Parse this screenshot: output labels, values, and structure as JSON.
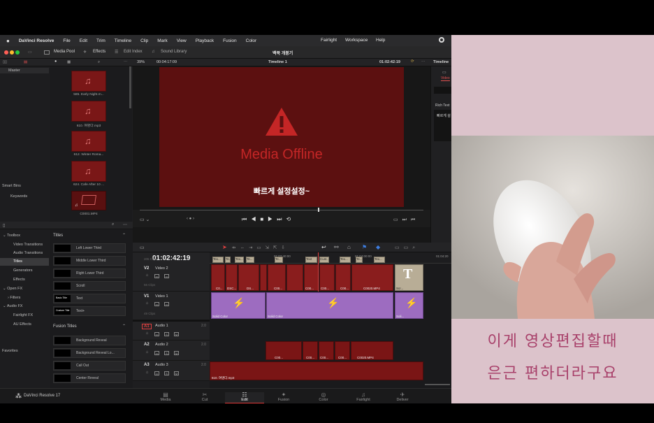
{
  "menubar": {
    "apple": "",
    "app": "DaVinci Resolve",
    "items": [
      "File",
      "Edit",
      "Trim",
      "Timeline",
      "Clip",
      "Mark",
      "View",
      "Playback",
      "Fusion",
      "Color"
    ],
    "right_items": [
      "Fairlight",
      "Workspace",
      "Help"
    ]
  },
  "toolbar": {
    "media_pool": "Media Pool",
    "effects": "Effects",
    "edit_index": "Edit Index",
    "sound_library": "Sound Library",
    "project_title": "백북 개봉기"
  },
  "viewer_bar": {
    "zoom": "39%",
    "timecode_left": "00:04:17:09",
    "timeline_name": "Timeline 1",
    "timecode_right": "01:02:42:19",
    "inspector_title": "Timeline"
  },
  "inspector": {
    "video_tab": "Video",
    "rich_text": "Rich Text",
    "sample": "빠르게 설"
  },
  "media_pool": {
    "master": "Master",
    "clips": [
      "585. Early Night.m...",
      "610. 여명다.mp3",
      "612. Winter Roma...",
      "624. Cafe After 10 ...",
      "C0001.MP4"
    ],
    "smart_bins": "Smart Bins",
    "keywords": "Keywords"
  },
  "viewer": {
    "offline_text": "Media Offline",
    "subtitle": "빠르게 설정설정~"
  },
  "effects_tree": {
    "toolbox": "Toolbox",
    "video_transitions": "Video Transitions",
    "audio_transitions": "Audio Transitions",
    "titles": "Titles",
    "generators": "Generators",
    "effects": "Effects",
    "open_fx": "Open FX",
    "filters": "Filters",
    "audio_fx": "Audio FX",
    "fairlight_fx": "Fairlight FX",
    "au_effects": "AU Effects",
    "favorites": "Favorites"
  },
  "titles_panel": {
    "header": "Titles",
    "items": [
      "Left Lower Third",
      "Middle Lower Third",
      "Right Lower Third",
      "Scroll",
      "Text",
      "Text+"
    ],
    "fusion_header": "Fusion Titles",
    "fusion_items": [
      "Background Reveal",
      "Background Reveal Lo...",
      "Call Out",
      "Center Reveal"
    ],
    "thumb_labels": [
      "Basic Title",
      "Custom Title"
    ]
  },
  "timeline": {
    "timecode": "01:02:42:19",
    "ruler": [
      "01:03:40:00",
      "01:04:00:00",
      "01:04:20"
    ],
    "tracks": [
      {
        "id": "V2",
        "name": "Video 2",
        "clips_count": "56 Clips"
      },
      {
        "id": "V1",
        "name": "Video 1",
        "clips_count": "49 Clips"
      },
      {
        "id": "A1",
        "name": "Audio 1",
        "level": "2.0"
      },
      {
        "id": "A2",
        "name": "Audio 2",
        "level": "2.0"
      },
      {
        "id": "A3",
        "name": "Audio 3",
        "level": "2.0"
      }
    ],
    "v2_clips": [
      "C0...",
      "DSC...",
      "DS...",
      "C00...",
      "C00...",
      "C00...",
      "C00...",
      "C0020.MP4",
      "Scr..."
    ],
    "text_clips": [
      "Tex...",
      "Te...",
      "Tex...",
      "Te...",
      "Te...",
      "Text",
      "Cust...",
      "Tex...",
      "Te...",
      "Tex..."
    ],
    "v1_clips": [
      "Solid Color",
      "Solid Color",
      "Soli..."
    ],
    "a2_clips": [
      "C00...",
      "C00...",
      "C00...",
      "C00...",
      "C0020.MP4"
    ],
    "a3_clip": "610. 여명다.mp3",
    "hidden_track_label": "205 Clips"
  },
  "pages": {
    "brand": "DaVinci Resolve 17",
    "items": [
      "Media",
      "Cut",
      "Edit",
      "Fusion",
      "Color",
      "Fairlight",
      "Deliver"
    ],
    "active": "Edit"
  },
  "caption": {
    "line1": "이게 영상편집할때",
    "line2": "은근 편하더라구요"
  },
  "colors": {
    "accent": "#e23b3b",
    "offline_bg": "#5c1010",
    "caption_bg": "#dcc3cb",
    "caption_text": "#a8406a",
    "v1_clip": "#9d6cc0",
    "title_clip": "#b8ad96"
  }
}
